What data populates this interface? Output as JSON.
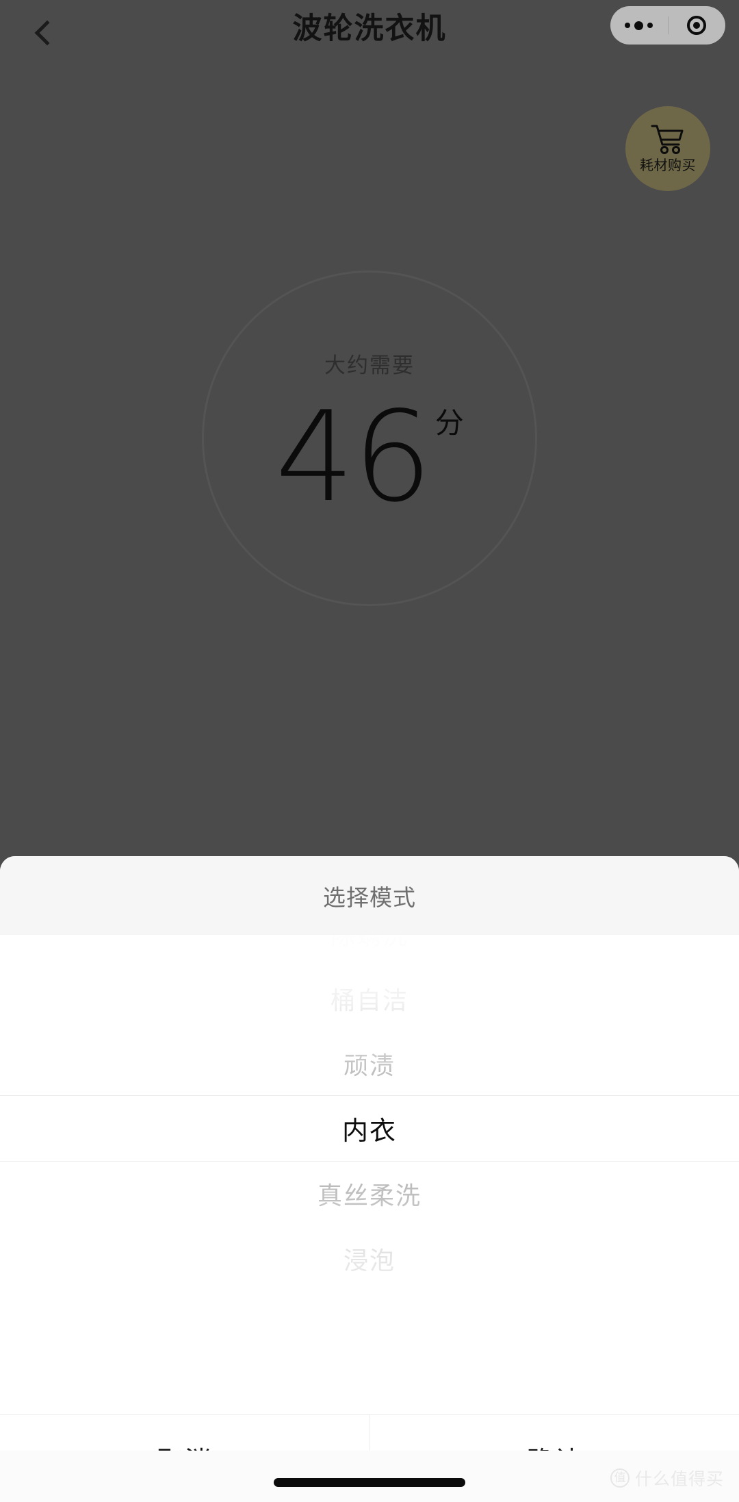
{
  "navbar": {
    "back_icon": "chevron-left-icon",
    "title": "波轮洗衣机",
    "capsule": {
      "menu_icon": "more-dots-icon",
      "close_icon": "target-circle-icon"
    }
  },
  "cart_badge": {
    "icon": "shopping-cart-icon",
    "label": "耗材购买",
    "background_color": "#6e6848"
  },
  "dial": {
    "caption": "大约需要",
    "value": "46",
    "unit": "分"
  },
  "sheet": {
    "title": "选择模式",
    "options": [
      {
        "label": "除螨洗",
        "state": "far"
      },
      {
        "label": "桶自洁",
        "state": "near"
      },
      {
        "label": "顽渍",
        "state": "near"
      },
      {
        "label": "内衣",
        "state": "selected"
      },
      {
        "label": "真丝柔洗",
        "state": "near"
      },
      {
        "label": "浸泡",
        "state": "far"
      }
    ],
    "selected_value": "内衣",
    "cancel_label": "取消",
    "confirm_label": "确认"
  },
  "watermark": {
    "logo_char": "值",
    "text": "什么值得买"
  },
  "colors": {
    "overlay": "#4b4b4b",
    "sheet_background": "#ffffff",
    "sheet_header": "#f6f6f6",
    "accent_cart": "#6e6848",
    "selected_text": "#0d0d0d",
    "dim_text": "#c9c9c9"
  }
}
